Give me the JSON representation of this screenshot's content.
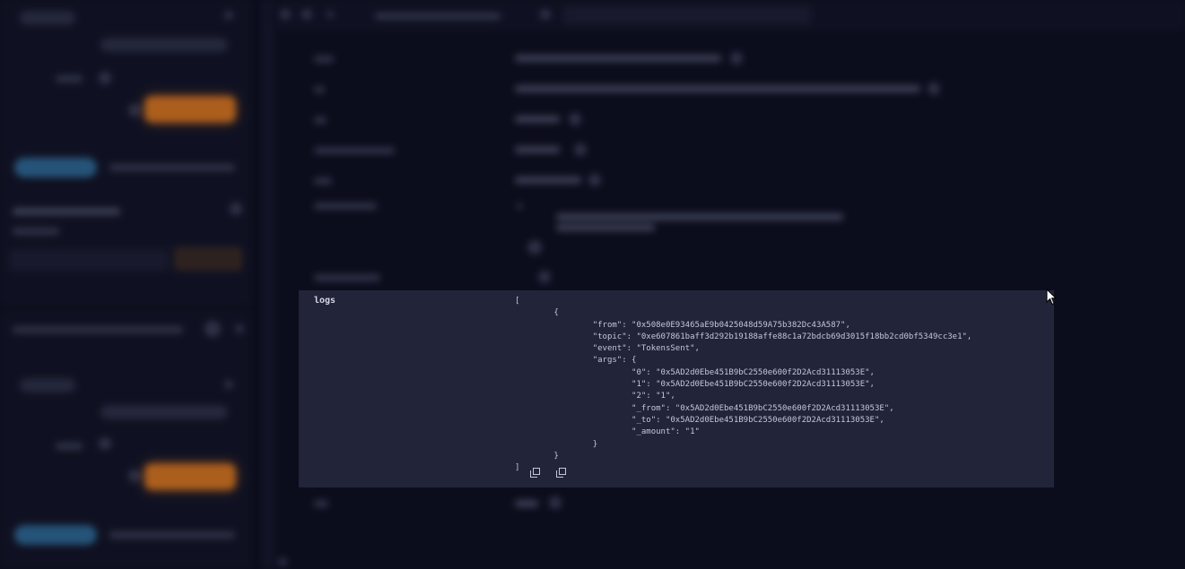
{
  "logs": {
    "label": "logs",
    "open_bracket": "[",
    "line_open_brace": "        {",
    "from_line": "                \"from\": \"0x508e0E93465aE9b0425048d59A75b382Dc43A587\",",
    "topic_line": "                \"topic\": \"0xe607861baff3d292b19188affe88c1a72bdcb69d3015f18bb2cd0bf5349cc3e1\",",
    "event_line": "                \"event\": \"TokensSent\",",
    "args_line": "                \"args\": {",
    "arg0_line": "                        \"0\": \"0x5AD2d0Ebe451B9bC2550e600f2D2Acd31113053E\",",
    "arg1_line": "                        \"1\": \"0x5AD2d0Ebe451B9bC2550e600f2D2Acd31113053E\",",
    "arg2_line": "                        \"2\": \"1\",",
    "from_arg_line": "                        \"_from\": \"0x5AD2d0Ebe451B9bC2550e600f2D2Acd31113053E\",",
    "to_arg_line": "                        \"_to\": \"0x5AD2d0Ebe451B9bC2550e600f2D2Acd31113053E\",",
    "amount_arg_line": "                        \"_amount\": \"1\"",
    "args_close_line": "                }",
    "close_brace_line": "        }",
    "close_bracket": "]"
  },
  "icons": {
    "copy_1": "copy-icon",
    "copy_2": "copy-icon",
    "cursor": "mouse-cursor"
  },
  "colors": {
    "panel_bg": "#22243a",
    "page_bg": "#0c0d1c",
    "accent_orange": "#e27a1e",
    "accent_blue": "#2e6c98"
  }
}
